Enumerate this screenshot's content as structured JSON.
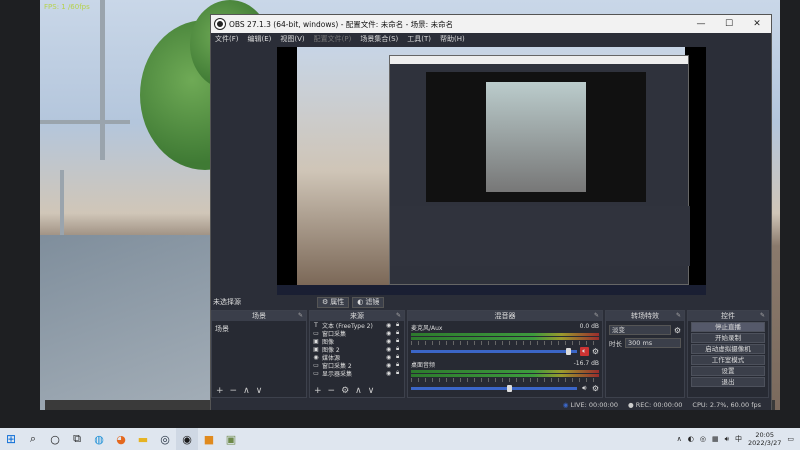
{
  "game": {
    "fps_text": "FPS: 1 /60fps"
  },
  "window": {
    "title": "OBS 27.1.3 (64-bit, windows) - 配置文件: 未命名 - 场景: 未命名",
    "minimize": "—",
    "maximize": "☐",
    "close": "✕"
  },
  "menu": [
    "文件(F)",
    "编辑(E)",
    "视图(V)",
    "配置文件(P)",
    "场景集合(S)",
    "工具(T)",
    "帮助(H)"
  ],
  "source_bar": {
    "no_source": "未选择源",
    "properties": "属性",
    "filters": "滤镜"
  },
  "docks": {
    "scenes": {
      "title": "场景",
      "items": [
        "场景"
      ]
    },
    "sources": {
      "title": "来源",
      "items": [
        {
          "icon": "T",
          "name": "文本 (FreeType 2)"
        },
        {
          "icon": "▭",
          "name": "窗口采集"
        },
        {
          "icon": "▣",
          "name": "图像"
        },
        {
          "icon": "▣",
          "name": "图像 2"
        },
        {
          "icon": "◉",
          "name": "媒体源"
        },
        {
          "icon": "▭",
          "name": "窗口采集 2"
        },
        {
          "icon": "▭",
          "name": "显示器采集"
        }
      ]
    },
    "mixer": {
      "title": "混音器",
      "channels": [
        {
          "name": "麦克风/Aux",
          "db": "0.0 dB",
          "level": 0.95
        },
        {
          "name": "桌面音频",
          "db": "-16.7 dB",
          "level": 0.6
        }
      ]
    },
    "transitions": {
      "title": "转场特效",
      "selected": "淡变",
      "duration_label": "时长",
      "duration_value": "300 ms"
    },
    "controls": {
      "title": "控件",
      "buttons": [
        "停止直播",
        "开始录制",
        "启动虚拟摄像机",
        "工作室模式",
        "设置",
        "退出"
      ]
    }
  },
  "status": {
    "live": "LIVE: 00:00:00",
    "rec": "REC: 00:00:00",
    "cpu": "CPU: 2.7%, 60.00 fps"
  },
  "taskbar": {
    "time": "20:05",
    "date": "2022/3/27",
    "ime": "中"
  },
  "colors": {
    "accent": "#3b66c7",
    "mute_active": "#cc3333"
  }
}
